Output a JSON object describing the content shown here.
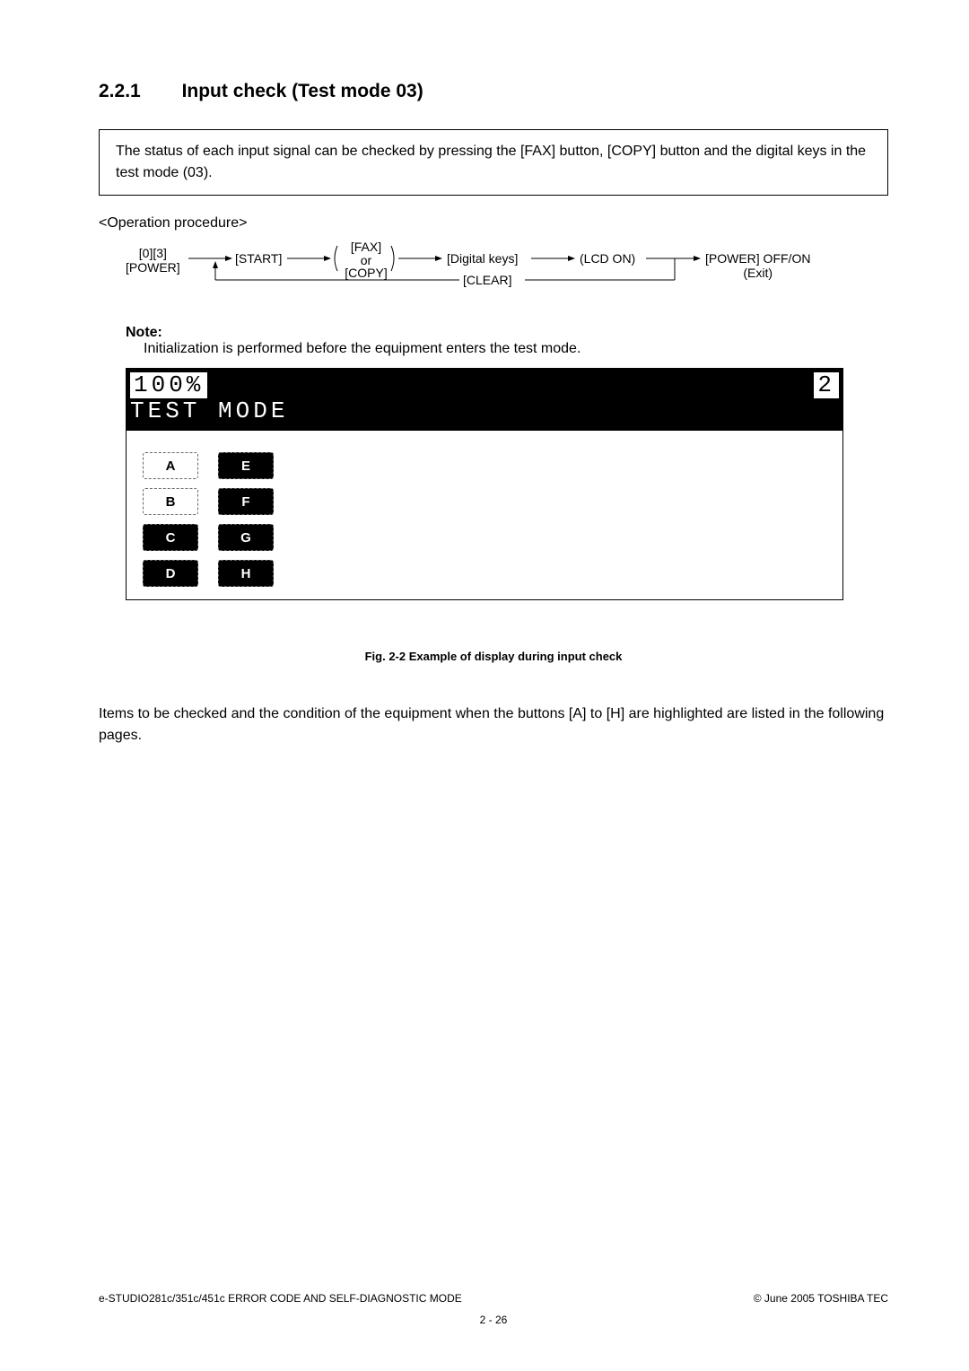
{
  "section": {
    "number": "2.2.1",
    "title": "Input check (Test mode 03)"
  },
  "status_box": "The status of each input signal can be checked by pressing the [FAX] button, [COPY] button and the digital keys in the test mode (03).",
  "op_proc_label": "<Operation procedure>",
  "flow": {
    "power": "[0][3]\n[POWER]",
    "start": "[START]",
    "fax": "[FAX]",
    "or": "or",
    "copy": "[COPY]",
    "digital": "[Digital keys]",
    "lcd": "(LCD ON)",
    "poweroff": "[POWER] OFF/ON",
    "exit": "(Exit)",
    "clear": "[CLEAR]"
  },
  "note": {
    "label": "Note:",
    "text": "Initialization is performed before the equipment enters the test mode."
  },
  "lcd": {
    "percent": "100%",
    "number": "2",
    "mode": "TEST MODE",
    "buttons": [
      {
        "label": "A",
        "highlight": false
      },
      {
        "label": "E",
        "highlight": true
      },
      {
        "label": "B",
        "highlight": false
      },
      {
        "label": "F",
        "highlight": true
      },
      {
        "label": "C",
        "highlight": true
      },
      {
        "label": "G",
        "highlight": true
      },
      {
        "label": "D",
        "highlight": true
      },
      {
        "label": "H",
        "highlight": true
      }
    ]
  },
  "fig_caption": "Fig. 2-2 Example of display during input check",
  "paragraph": "Items to be checked and the condition of the equipment when the buttons [A] to [H] are highlighted are listed in the following pages.",
  "footer": {
    "left": "e-STUDIO281c/351c/451c ERROR CODE AND SELF-DIAGNOSTIC MODE",
    "right": "© June 2005 TOSHIBA TEC",
    "page": "2 - 26"
  }
}
